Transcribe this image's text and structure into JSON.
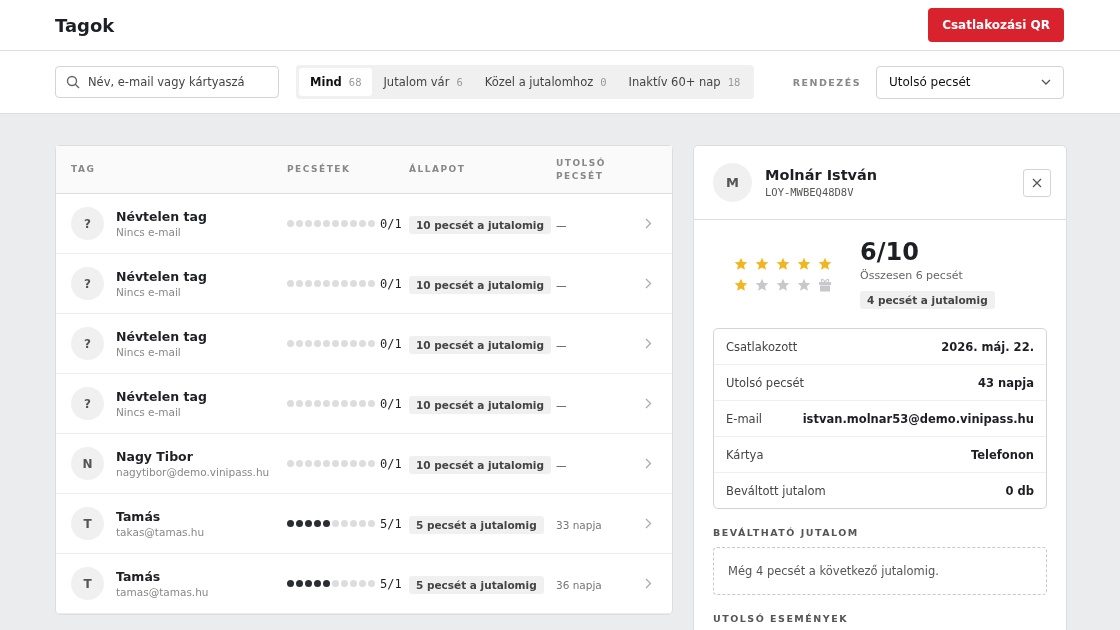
{
  "header": {
    "title": "Tagok",
    "button": "Csatlakozási QR"
  },
  "search": {
    "placeholder": "Név, e-mail vagy kártyaszá"
  },
  "tabs": [
    {
      "label": "Mind",
      "count": "68",
      "selected": true
    },
    {
      "label": "Jutalom vár",
      "count": "6",
      "selected": false
    },
    {
      "label": "Közel a jutalomhoz",
      "count": "0",
      "selected": false
    },
    {
      "label": "Inaktív 60+ nap",
      "count": "18",
      "selected": false
    }
  ],
  "sort": {
    "label": "RENDEZÉS",
    "value": "Utolsó pecsét"
  },
  "table": {
    "columns": [
      "TAG",
      "PECSÉTEK",
      "ÁLLAPOT",
      "UTOLSÓ PECSÉT"
    ],
    "rows": [
      {
        "initial": "?",
        "name": "Névtelen tag",
        "email": "Nincs e-mail",
        "stars": 0,
        "count": "0/1",
        "status": "10 pecsét a jutalomig",
        "last": "—"
      },
      {
        "initial": "?",
        "name": "Névtelen tag",
        "email": "Nincs e-mail",
        "stars": 0,
        "count": "0/1",
        "status": "10 pecsét a jutalomig",
        "last": "—"
      },
      {
        "initial": "?",
        "name": "Névtelen tag",
        "email": "Nincs e-mail",
        "stars": 0,
        "count": "0/1",
        "status": "10 pecsét a jutalomig",
        "last": "—"
      },
      {
        "initial": "?",
        "name": "Névtelen tag",
        "email": "Nincs e-mail",
        "stars": 0,
        "count": "0/1",
        "status": "10 pecsét a jutalomig",
        "last": "—"
      },
      {
        "initial": "N",
        "name": "Nagy Tibor",
        "email": "nagytibor@demo.vinipass.hu",
        "stars": 0,
        "count": "0/1",
        "status": "10 pecsét a jutalomig",
        "last": "—"
      },
      {
        "initial": "T",
        "name": "Tamás",
        "email": "takas@tamas.hu",
        "stars": 5,
        "count": "5/1",
        "status": "5 pecsét a jutalomig",
        "last": "33 napja"
      },
      {
        "initial": "T",
        "name": "Tamás",
        "email": "tamas@tamas.hu",
        "stars": 5,
        "count": "5/1",
        "status": "5 pecsét a jutalomig",
        "last": "36 napja"
      }
    ]
  },
  "detail": {
    "initial": "M",
    "name": "Molnár István",
    "code": "LOY-MWBEQ48D8V",
    "stamps": [
      {
        "filled": true
      },
      {
        "filled": true
      },
      {
        "filled": true
      },
      {
        "filled": true
      },
      {
        "filled": true
      },
      {
        "filled": true
      },
      {
        "filled": false
      },
      {
        "filled": false
      },
      {
        "filled": false
      }
    ],
    "score": "6/10",
    "total": "Összesen 6 pecsét",
    "badge": "4 pecsét a jutalomig",
    "facts": [
      {
        "label": "Csatlakozott",
        "value": "2026. máj. 22."
      },
      {
        "label": "Utolsó pecsét",
        "value": "43 napja"
      },
      {
        "label": "E-mail",
        "value": "istvan.molnar53@demo.vinipass.hu"
      },
      {
        "label": "Kártya",
        "value": "Telefonon"
      },
      {
        "label": "Beváltott jutalom",
        "value": "0 db"
      }
    ],
    "reward_heading": "BEVÁLTHATÓ JUTALOM",
    "reward_note": "Még 4 pecsét a következő jutalomig.",
    "events_heading": "UTOLSÓ ESEMÉNYEK"
  }
}
